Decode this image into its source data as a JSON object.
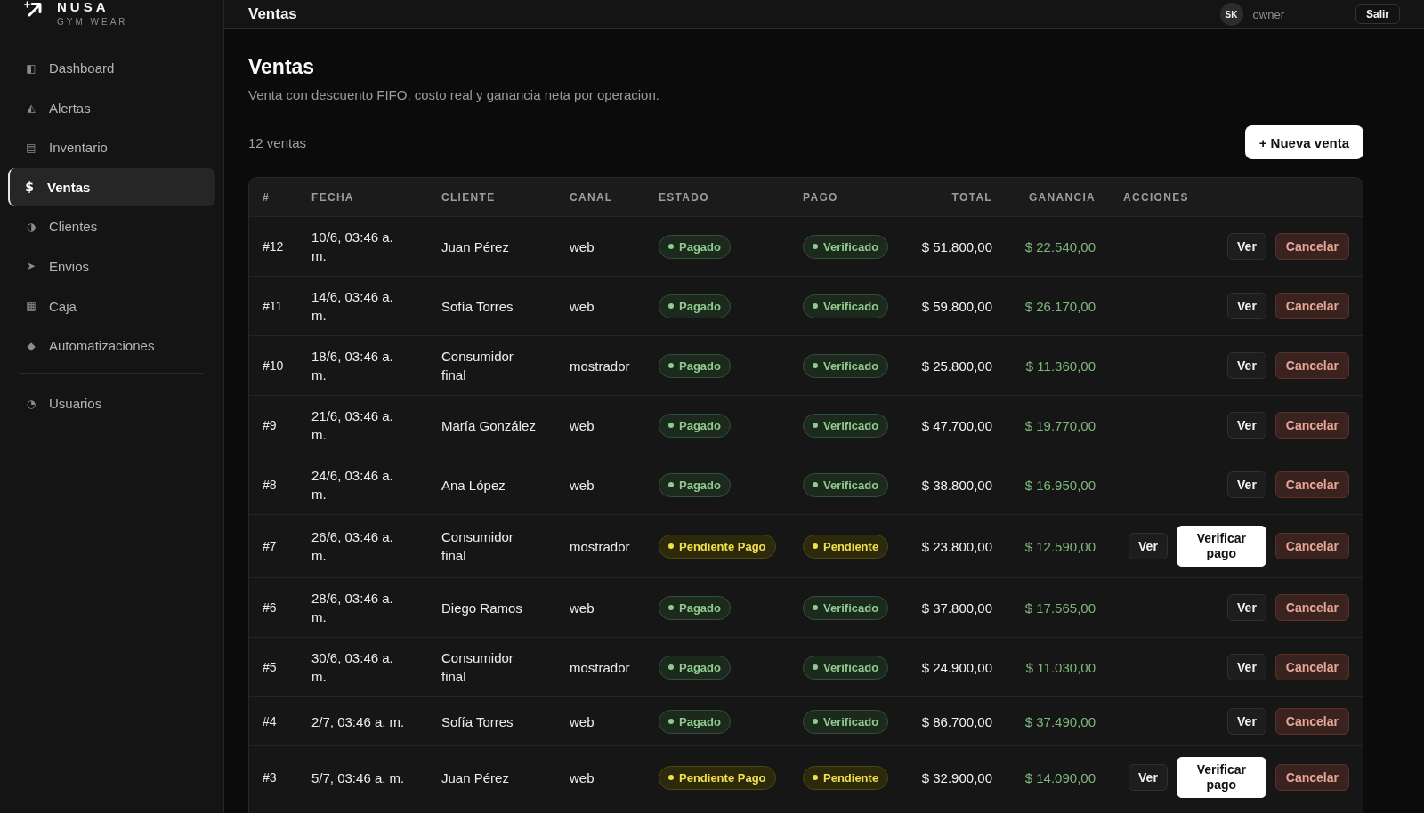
{
  "sidebar": {
    "brand": {
      "name": "NUSA",
      "tagline": "GYM WEAR"
    },
    "groups": [
      {
        "items": [
          {
            "icon": "◧",
            "label": "Dashboard",
            "selected": false
          },
          {
            "icon": "◭",
            "label": "Alertas",
            "selected": false
          },
          {
            "icon": "▤",
            "label": "Inventario",
            "selected": false
          },
          {
            "icon": "$",
            "label": "Ventas",
            "selected": true
          },
          {
            "icon": "◑",
            "label": "Clientes",
            "selected": false
          },
          {
            "icon": "➤",
            "label": "Envios",
            "selected": false
          },
          {
            "icon": "▦",
            "label": "Caja",
            "selected": false
          },
          {
            "icon": "◆",
            "label": "Automatizaciones",
            "selected": false
          }
        ]
      },
      {
        "items": [
          {
            "icon": "◔",
            "label": "Usuarios",
            "selected": false
          }
        ]
      }
    ]
  },
  "topbar": {
    "title": "Ventas",
    "user": {
      "initials": "SK",
      "role": "owner"
    },
    "logout_button": "Salir"
  },
  "page": {
    "title": "Ventas",
    "subtitle": "Venta con descuento FIFO, costo real y ganancia neta por operacion.",
    "count": "12 ventas",
    "new_button": "+ Nueva venta"
  },
  "table": {
    "columns": [
      "#",
      "FECHA",
      "CLIENTE",
      "CANAL",
      "ESTADO",
      "PAGO",
      "TOTAL",
      "GANANCIA",
      "ACCIONES"
    ],
    "rows": [
      {
        "id": "#12",
        "fecha": "10/6, 03:46 a. m.",
        "cliente": "Juan Pérez",
        "canal": "web",
        "estado": {
          "label": "Pagado",
          "kind": "success"
        },
        "pago": {
          "label": "Verificado",
          "kind": "success"
        },
        "total": "$ 51.800,00",
        "ganancia": "$ 22.540,00",
        "actions": [
          {
            "label": "Ver",
            "kind": "view"
          },
          {
            "label": "Cancelar",
            "kind": "cancel"
          }
        ]
      },
      {
        "id": "#11",
        "fecha": "14/6, 03:46 a. m.",
        "cliente": "Sofía Torres",
        "canal": "web",
        "estado": {
          "label": "Pagado",
          "kind": "success"
        },
        "pago": {
          "label": "Verificado",
          "kind": "success"
        },
        "total": "$ 59.800,00",
        "ganancia": "$ 26.170,00",
        "actions": [
          {
            "label": "Ver",
            "kind": "view"
          },
          {
            "label": "Cancelar",
            "kind": "cancel"
          }
        ]
      },
      {
        "id": "#10",
        "fecha": "18/6, 03:46 a. m.",
        "cliente": "Consumidor final",
        "canal": "mostrador",
        "estado": {
          "label": "Pagado",
          "kind": "success"
        },
        "pago": {
          "label": "Verificado",
          "kind": "success"
        },
        "total": "$ 25.800,00",
        "ganancia": "$ 11.360,00",
        "actions": [
          {
            "label": "Ver",
            "kind": "view"
          },
          {
            "label": "Cancelar",
            "kind": "cancel"
          }
        ]
      },
      {
        "id": "#9",
        "fecha": "21/6, 03:46 a. m.",
        "cliente": "María González",
        "canal": "web",
        "estado": {
          "label": "Pagado",
          "kind": "success"
        },
        "pago": {
          "label": "Verificado",
          "kind": "success"
        },
        "total": "$ 47.700,00",
        "ganancia": "$ 19.770,00",
        "actions": [
          {
            "label": "Ver",
            "kind": "view"
          },
          {
            "label": "Cancelar",
            "kind": "cancel"
          }
        ]
      },
      {
        "id": "#8",
        "fecha": "24/6, 03:46 a. m.",
        "cliente": "Ana López",
        "canal": "web",
        "estado": {
          "label": "Pagado",
          "kind": "success"
        },
        "pago": {
          "label": "Verificado",
          "kind": "success"
        },
        "total": "$ 38.800,00",
        "ganancia": "$ 16.950,00",
        "actions": [
          {
            "label": "Ver",
            "kind": "view"
          },
          {
            "label": "Cancelar",
            "kind": "cancel"
          }
        ]
      },
      {
        "id": "#7",
        "fecha": "26/6, 03:46 a. m.",
        "cliente": "Consumidor final",
        "canal": "mostrador",
        "estado": {
          "label": "Pendiente Pago",
          "kind": "warning"
        },
        "pago": {
          "label": "Pendiente",
          "kind": "warning"
        },
        "total": "$ 23.800,00",
        "ganancia": "$ 12.590,00",
        "actions": [
          {
            "label": "Ver",
            "kind": "view"
          },
          {
            "label": "Verificar pago",
            "kind": "verify"
          },
          {
            "label": "Cancelar",
            "kind": "cancel"
          }
        ]
      },
      {
        "id": "#6",
        "fecha": "28/6, 03:46 a. m.",
        "cliente": "Diego Ramos",
        "canal": "web",
        "estado": {
          "label": "Pagado",
          "kind": "success"
        },
        "pago": {
          "label": "Verificado",
          "kind": "success"
        },
        "total": "$ 37.800,00",
        "ganancia": "$ 17.565,00",
        "actions": [
          {
            "label": "Ver",
            "kind": "view"
          },
          {
            "label": "Cancelar",
            "kind": "cancel"
          }
        ]
      },
      {
        "id": "#5",
        "fecha": "30/6, 03:46 a. m.",
        "cliente": "Consumidor final",
        "canal": "mostrador",
        "estado": {
          "label": "Pagado",
          "kind": "success"
        },
        "pago": {
          "label": "Verificado",
          "kind": "success"
        },
        "total": "$ 24.900,00",
        "ganancia": "$ 11.030,00",
        "actions": [
          {
            "label": "Ver",
            "kind": "view"
          },
          {
            "label": "Cancelar",
            "kind": "cancel"
          }
        ]
      },
      {
        "id": "#4",
        "fecha": "2/7, 03:46 a. m.",
        "cliente": "Sofía Torres",
        "canal": "web",
        "estado": {
          "label": "Pagado",
          "kind": "success"
        },
        "pago": {
          "label": "Verificado",
          "kind": "success"
        },
        "total": "$ 86.700,00",
        "ganancia": "$ 37.490,00",
        "actions": [
          {
            "label": "Ver",
            "kind": "view"
          },
          {
            "label": "Cancelar",
            "kind": "cancel"
          }
        ]
      },
      {
        "id": "#3",
        "fecha": "5/7, 03:46 a. m.",
        "cliente": "Juan Pérez",
        "canal": "web",
        "estado": {
          "label": "Pendiente Pago",
          "kind": "warning"
        },
        "pago": {
          "label": "Pendiente",
          "kind": "warning"
        },
        "total": "$ 32.900,00",
        "ganancia": "$ 14.090,00",
        "actions": [
          {
            "label": "Ver",
            "kind": "view"
          },
          {
            "label": "Verificar pago",
            "kind": "verify"
          },
          {
            "label": "Cancelar",
            "kind": "cancel"
          }
        ]
      }
    ]
  }
}
